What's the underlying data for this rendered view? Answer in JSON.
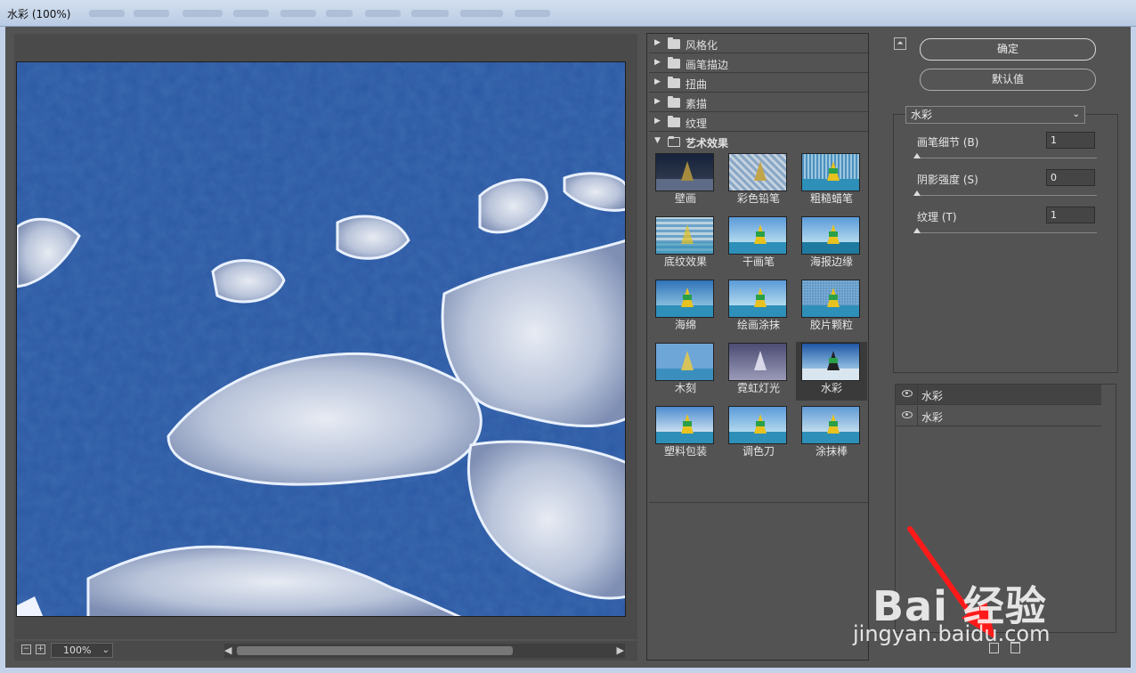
{
  "window": {
    "title": "水彩 (100%)"
  },
  "preview": {
    "zoom": "100%"
  },
  "gallery": {
    "categories": [
      {
        "label": "风格化",
        "expanded": false
      },
      {
        "label": "画笔描边",
        "expanded": false
      },
      {
        "label": "扭曲",
        "expanded": false
      },
      {
        "label": "素描",
        "expanded": false
      },
      {
        "label": "纹理",
        "expanded": false
      },
      {
        "label": "艺术效果",
        "expanded": true
      }
    ],
    "filters": [
      {
        "label": "壁画"
      },
      {
        "label": "彩色铅笔"
      },
      {
        "label": "粗糙蜡笔"
      },
      {
        "label": "底纹效果"
      },
      {
        "label": "干画笔"
      },
      {
        "label": "海报边缘"
      },
      {
        "label": "海绵"
      },
      {
        "label": "绘画涂抹"
      },
      {
        "label": "胶片颗粒"
      },
      {
        "label": "木刻"
      },
      {
        "label": "霓虹灯光"
      },
      {
        "label": "水彩",
        "selected": true
      },
      {
        "label": "塑料包装"
      },
      {
        "label": "调色刀"
      },
      {
        "label": "涂抹棒"
      }
    ]
  },
  "buttons": {
    "ok": "确定",
    "defaults": "默认值"
  },
  "settings": {
    "filter_name": "水彩",
    "params": [
      {
        "label": "画笔细节 (B)",
        "value": "1"
      },
      {
        "label": "阴影强度 (S)",
        "value": "0"
      },
      {
        "label": "纹理 (T)",
        "value": "1"
      }
    ]
  },
  "layers": [
    {
      "name": "水彩",
      "active": true
    },
    {
      "name": "水彩",
      "active": false
    }
  ],
  "watermark": {
    "logo": "Bai 经验",
    "url": "jingyan.baidu.com"
  }
}
